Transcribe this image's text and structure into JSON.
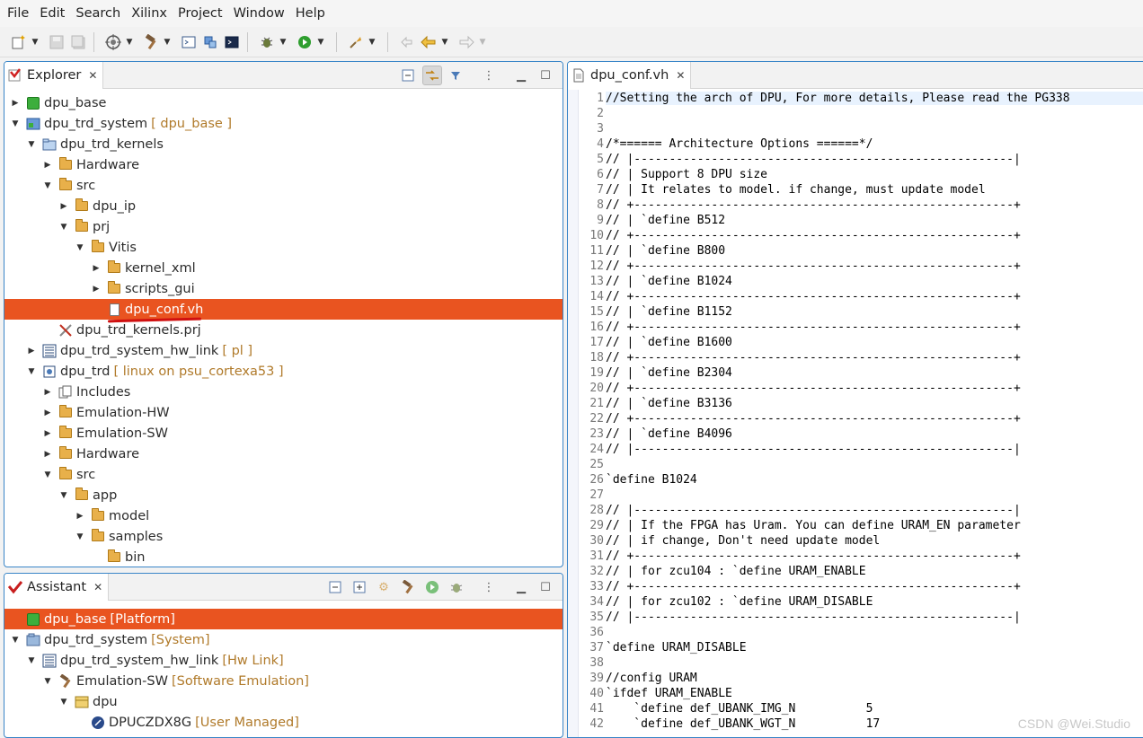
{
  "menu": [
    "File",
    "Edit",
    "Search",
    "Xilinx",
    "Project",
    "Window",
    "Help"
  ],
  "toolbar_icons": [
    "new-wizard-icon",
    "save-icon",
    "save-all-icon",
    "target-icon",
    "build-hammer-icon",
    "terminal-icon",
    "connect-icon",
    "console-icon",
    "debug-bug-icon",
    "run-icon",
    "external-tools-icon",
    "prev-edit-icon",
    "back-arrow-icon",
    "forward-arrow-icon"
  ],
  "explorer": {
    "title": "Explorer",
    "rows": [
      {
        "label": "dpu_base",
        "deco": ""
      },
      {
        "label": "dpu_trd_system",
        "deco": "[ dpu_base ]"
      },
      {
        "label": "dpu_trd_kernels",
        "deco": ""
      },
      {
        "label": "Hardware",
        "deco": ""
      },
      {
        "label": "src",
        "deco": ""
      },
      {
        "label": "dpu_ip",
        "deco": ""
      },
      {
        "label": "prj",
        "deco": ""
      },
      {
        "label": "Vitis",
        "deco": ""
      },
      {
        "label": "kernel_xml",
        "deco": ""
      },
      {
        "label": "scripts_gui",
        "deco": ""
      },
      {
        "label": "dpu_conf.vh",
        "deco": ""
      },
      {
        "label": "dpu_trd_kernels.prj",
        "deco": ""
      },
      {
        "label": "dpu_trd_system_hw_link",
        "deco": "[ pl ]"
      },
      {
        "label": "dpu_trd",
        "deco": "[ linux on psu_cortexa53 ]"
      },
      {
        "label": "Includes",
        "deco": ""
      },
      {
        "label": "Emulation-HW",
        "deco": ""
      },
      {
        "label": "Emulation-SW",
        "deco": ""
      },
      {
        "label": "Hardware",
        "deco": ""
      },
      {
        "label": "src",
        "deco": ""
      },
      {
        "label": "app",
        "deco": ""
      },
      {
        "label": "model",
        "deco": ""
      },
      {
        "label": "samples",
        "deco": ""
      },
      {
        "label": "bin",
        "deco": ""
      }
    ]
  },
  "assistant": {
    "title": "Assistant",
    "rows": [
      {
        "label": "dpu_base",
        "deco": "[Platform]"
      },
      {
        "label": "dpu_trd_system",
        "deco": "[System]"
      },
      {
        "label": "dpu_trd_system_hw_link",
        "deco": "[Hw Link]"
      },
      {
        "label": "Emulation-SW",
        "deco": "[Software Emulation]"
      },
      {
        "label": "dpu",
        "deco": ""
      },
      {
        "label": "DPUCZDX8G",
        "deco": "[User Managed]"
      }
    ]
  },
  "editor": {
    "tab": "dpu_conf.vh",
    "lines": [
      {
        "n": "1",
        "text": "//Setting the arch of DPU, For more details, Please read the PG338"
      },
      {
        "n": "2",
        "text": ""
      },
      {
        "n": "3",
        "text": ""
      },
      {
        "n": "4",
        "text": "/*====== Architecture Options ======*/"
      },
      {
        "n": "5",
        "text": "// |------------------------------------------------------|"
      },
      {
        "n": "6",
        "text": "// | Support 8 DPU size"
      },
      {
        "n": "7",
        "text": "// | It relates to model. if change, must update model"
      },
      {
        "n": "8",
        "text": "// +------------------------------------------------------+"
      },
      {
        "n": "9",
        "text": "// | `define B512"
      },
      {
        "n": "10",
        "text": "// +------------------------------------------------------+"
      },
      {
        "n": "11",
        "text": "// | `define B800"
      },
      {
        "n": "12",
        "text": "// +------------------------------------------------------+"
      },
      {
        "n": "13",
        "text": "// | `define B1024"
      },
      {
        "n": "14",
        "text": "// +------------------------------------------------------+"
      },
      {
        "n": "15",
        "text": "// | `define B1152"
      },
      {
        "n": "16",
        "text": "// +------------------------------------------------------+"
      },
      {
        "n": "17",
        "text": "// | `define B1600"
      },
      {
        "n": "18",
        "text": "// +------------------------------------------------------+"
      },
      {
        "n": "19",
        "text": "// | `define B2304"
      },
      {
        "n": "20",
        "text": "// +------------------------------------------------------+"
      },
      {
        "n": "21",
        "text": "// | `define B3136"
      },
      {
        "n": "22",
        "text": "// +------------------------------------------------------+"
      },
      {
        "n": "23",
        "text": "// | `define B4096"
      },
      {
        "n": "24",
        "text": "// |------------------------------------------------------|"
      },
      {
        "n": "25",
        "text": ""
      },
      {
        "n": "26",
        "text": "`define B1024"
      },
      {
        "n": "27",
        "text": ""
      },
      {
        "n": "28",
        "text": "// |------------------------------------------------------|"
      },
      {
        "n": "29",
        "text": "// | If the FPGA has Uram. You can define URAM_EN parameter"
      },
      {
        "n": "30",
        "text": "// | if change, Don't need update model"
      },
      {
        "n": "31",
        "text": "// +------------------------------------------------------+"
      },
      {
        "n": "32",
        "text": "// | for zcu104 : `define URAM_ENABLE"
      },
      {
        "n": "33",
        "text": "// +------------------------------------------------------+"
      },
      {
        "n": "34",
        "text": "// | for zcu102 : `define URAM_DISABLE"
      },
      {
        "n": "35",
        "text": "// |------------------------------------------------------|"
      },
      {
        "n": "36",
        "text": ""
      },
      {
        "n": "37",
        "text": "`define URAM_DISABLE"
      },
      {
        "n": "38",
        "text": ""
      },
      {
        "n": "39",
        "text": "//config URAM"
      },
      {
        "n": "40",
        "text": "`ifdef URAM_ENABLE"
      },
      {
        "n": "41",
        "text": "    `define def_UBANK_IMG_N          5"
      },
      {
        "n": "42",
        "text": "    `define def_UBANK_WGT_N          17"
      }
    ]
  },
  "watermark": "CSDN @Wei.Studio",
  "colors": {
    "selection": "#e95420",
    "panel_border": "#3a86c8",
    "decoration": "#b07a2a"
  }
}
